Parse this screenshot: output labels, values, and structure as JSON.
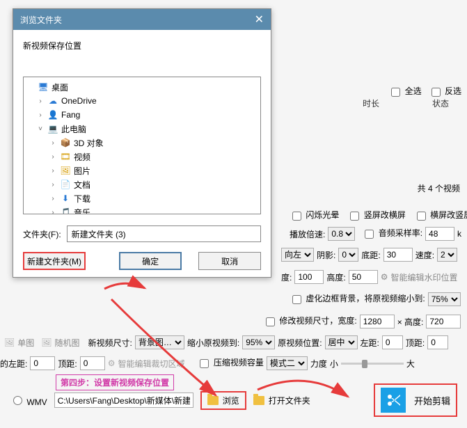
{
  "dialog": {
    "title": "浏览文件夹",
    "subtitle": "新视频保存位置",
    "tree": [
      {
        "label": "桌面",
        "icon": "desktop",
        "indent": 0,
        "exp": ""
      },
      {
        "label": "OneDrive",
        "icon": "cloud",
        "indent": 1,
        "exp": "›"
      },
      {
        "label": "Fang",
        "icon": "user",
        "indent": 1,
        "exp": "›"
      },
      {
        "label": "此电脑",
        "icon": "pc",
        "indent": 1,
        "exp": "˅"
      },
      {
        "label": "3D 对象",
        "icon": "3d",
        "indent": 2,
        "exp": "›"
      },
      {
        "label": "视频",
        "icon": "video",
        "indent": 2,
        "exp": "›"
      },
      {
        "label": "图片",
        "icon": "image",
        "indent": 2,
        "exp": "›"
      },
      {
        "label": "文档",
        "icon": "doc",
        "indent": 2,
        "exp": "›"
      },
      {
        "label": "下载",
        "icon": "download",
        "indent": 2,
        "exp": "›"
      },
      {
        "label": "音乐",
        "icon": "music",
        "indent": 2,
        "exp": "›"
      }
    ],
    "folder_label": "文件夹(F):",
    "folder_value": "新建文件夹 (3)",
    "new_folder_btn": "新建文件夹(M)",
    "ok_btn": "确定",
    "cancel_btn": "取消"
  },
  "bg": {
    "select_all": "全选",
    "invert_sel": "反选",
    "col_duration": "时长",
    "col_status": "状态",
    "total_videos": "共 4 个视频",
    "flash_halo": "闪烁光晕",
    "portrait_to_land": "竖屏改横屏",
    "land_to_portrait": "横屏改竖屏",
    "play_speed_label": "播放倍速:",
    "play_speed": "0.8",
    "audio_rate_label": "音频采样率:",
    "audio_rate": "48",
    "audio_rate_unit": "k",
    "dir_label": "向左",
    "shadow_label": "阴影:",
    "shadow": "0",
    "bottom_margin_label": "底距:",
    "bottom_margin": "30",
    "speed_label": "速度:",
    "speed": "2",
    "width_label": "度:",
    "width": "100",
    "height_label": "高度:",
    "height": "50",
    "smart_wm": "智能编辑水印位置",
    "virtual_border": "虚化边框背景，将原视频缩小到:",
    "virtual_border_pct": "75%",
    "modify_size": "修改视频尺寸，宽度:",
    "mod_w": "1280",
    "mod_x": "× 高度:",
    "mod_h": "720",
    "single_img": "单图",
    "random_img": "随机图",
    "new_size_label": "新视频尺寸:",
    "new_size": "背景图…",
    "shrink_label": "缩小原视频到:",
    "shrink": "95%",
    "orig_pos_label": "原视频位置:",
    "orig_pos": "居中",
    "left_margin_label": "左距:",
    "left_margin": "0",
    "top_margin_label": "顶距:",
    "top_margin": "0",
    "left_margin2_label": "的左距:",
    "left_margin2": "0",
    "top_margin2_label": "顶距:",
    "top_margin2": "0",
    "smart_crop": "智能编辑裁切区域",
    "compress": "压缩视频容量",
    "mode_label": "模式二",
    "force_label": "力度",
    "small": "小",
    "big": "大",
    "wmv": "WMV",
    "path": "C:\\Users\\Fang\\Desktop\\新媒体\\新建",
    "browse": "浏览",
    "open_folder": "打开文件夹",
    "start_edit": "开始剪辑"
  },
  "annotation": {
    "step4": "第四步：设置新视频保存位置"
  }
}
